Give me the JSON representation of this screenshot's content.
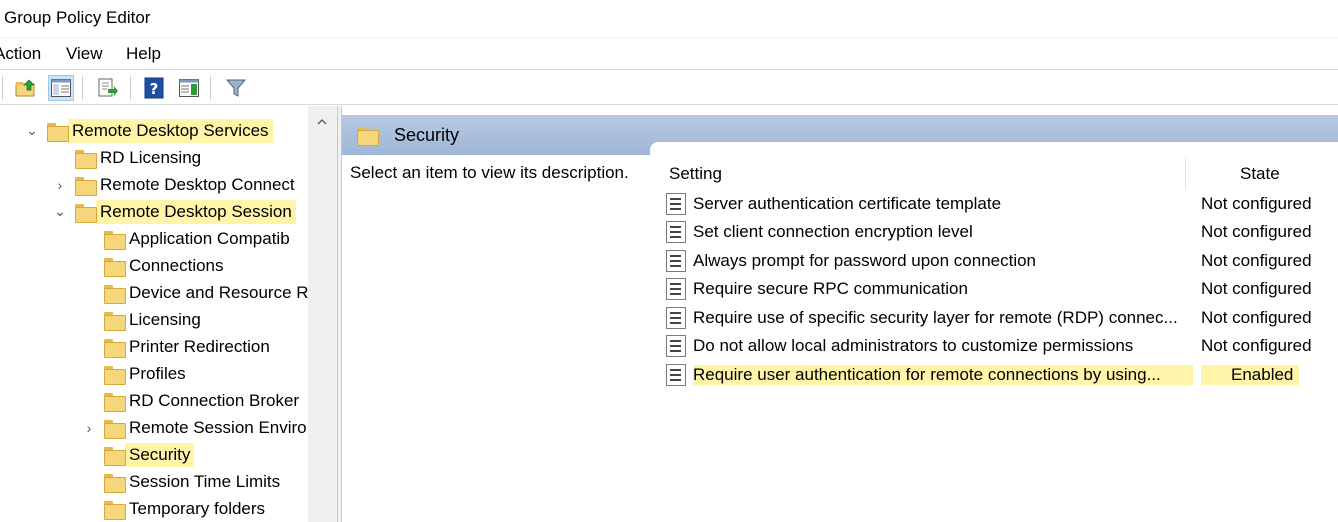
{
  "window": {
    "title": "Group Policy Editor"
  },
  "menu": [
    "Action",
    "View",
    "Help"
  ],
  "toolbar": {
    "buttons": [
      "up-folder-icon",
      "show-hide-tree-icon",
      "export-list-icon",
      "help-icon",
      "show-hide-action-pane-icon",
      "filter-icon"
    ]
  },
  "tree": {
    "items": [
      {
        "label": "Remote Desktop Services",
        "expander": "expanded",
        "highlight": true
      },
      {
        "label": "RD Licensing",
        "expander": "none"
      },
      {
        "label": "Remote Desktop Connect",
        "expander": "collapsed"
      },
      {
        "label": "Remote Desktop Session",
        "expander": "expanded",
        "highlight": true
      },
      {
        "label": "Application Compatib",
        "expander": "none"
      },
      {
        "label": "Connections",
        "expander": "none"
      },
      {
        "label": "Device and Resource R",
        "expander": "none"
      },
      {
        "label": "Licensing",
        "expander": "none"
      },
      {
        "label": "Printer Redirection",
        "expander": "none"
      },
      {
        "label": "Profiles",
        "expander": "none"
      },
      {
        "label": "RD Connection Broker",
        "expander": "none"
      },
      {
        "label": "Remote Session Enviro",
        "expander": "collapsed"
      },
      {
        "label": "Security",
        "expander": "none",
        "selected": true,
        "highlight": true
      },
      {
        "label": "Session Time Limits",
        "expander": "none"
      },
      {
        "label": "Temporary folders",
        "expander": "none"
      }
    ]
  },
  "details": {
    "header": "Security",
    "description": "Select an item to view its description.",
    "columns": {
      "setting": "Setting",
      "state": "State"
    },
    "rows": [
      {
        "setting": "Server authentication certificate template",
        "state": "Not configured"
      },
      {
        "setting": "Set client connection encryption level",
        "state": "Not configured"
      },
      {
        "setting": "Always prompt for password upon connection",
        "state": "Not configured"
      },
      {
        "setting": "Require secure RPC communication",
        "state": "Not configured"
      },
      {
        "setting": "Require use of specific security layer for remote (RDP) connec...",
        "state": "Not configured"
      },
      {
        "setting": "Do not allow local administrators to customize permissions",
        "state": "Not configured"
      },
      {
        "setting": "Require user authentication for remote connections by using...",
        "state": "Enabled",
        "highlight": true
      }
    ]
  },
  "colors": {
    "highlight": "#fff4a8",
    "header_band": "#a9bedc",
    "selection": "#e0e0e0"
  }
}
